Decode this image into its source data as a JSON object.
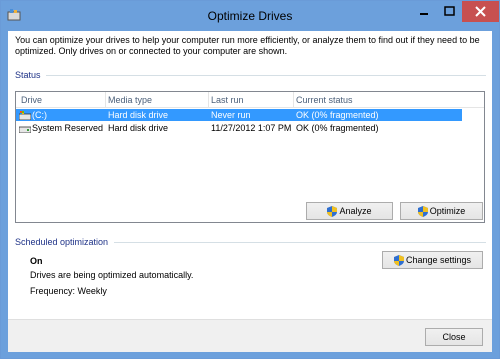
{
  "window": {
    "title": "Optimize Drives"
  },
  "description": "You can optimize your drives to help your computer run more efficiently, or analyze them to find out if they need to be optimized. Only drives on or connected to your computer are shown.",
  "status_section": {
    "title": "Status",
    "columns": [
      "Drive",
      "Media type",
      "Last run",
      "Current status"
    ],
    "rows": [
      {
        "drive": "(C:)",
        "media": "Hard disk drive",
        "last_run": "Never run",
        "status": "OK (0% fragmented)",
        "selected": true
      },
      {
        "drive": "System Reserved",
        "media": "Hard disk drive",
        "last_run": "11/27/2012 1:07 PM",
        "status": "OK (0% fragmented)",
        "selected": false
      }
    ],
    "analyze_label": "Analyze",
    "optimize_label": "Optimize"
  },
  "scheduled": {
    "title": "Scheduled optimization",
    "state": "On",
    "message": "Drives are being optimized automatically.",
    "frequency": "Frequency: Weekly",
    "change_settings_label": "Change settings"
  },
  "footer": {
    "close_label": "Close"
  },
  "colors": {
    "accent": "#6ca0dc",
    "selection": "#3399ff",
    "close_button": "#c75050",
    "section_title": "#1e3287"
  }
}
